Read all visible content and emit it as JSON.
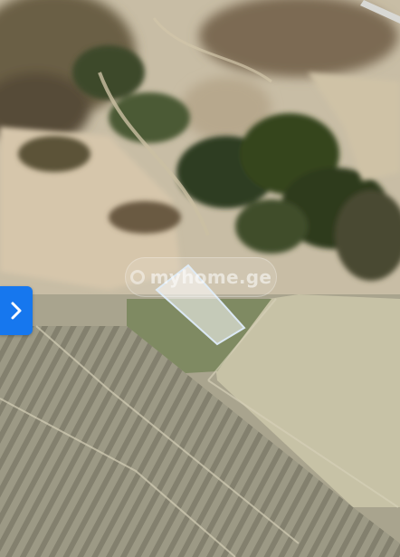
{
  "map": {
    "type": "satellite",
    "parcel_highlight_color": "#ffffff"
  },
  "watermark": {
    "text": "myhome.ge"
  },
  "controls": {
    "next_icon": "chevron-right-icon",
    "accent_color": "#1677ee"
  }
}
